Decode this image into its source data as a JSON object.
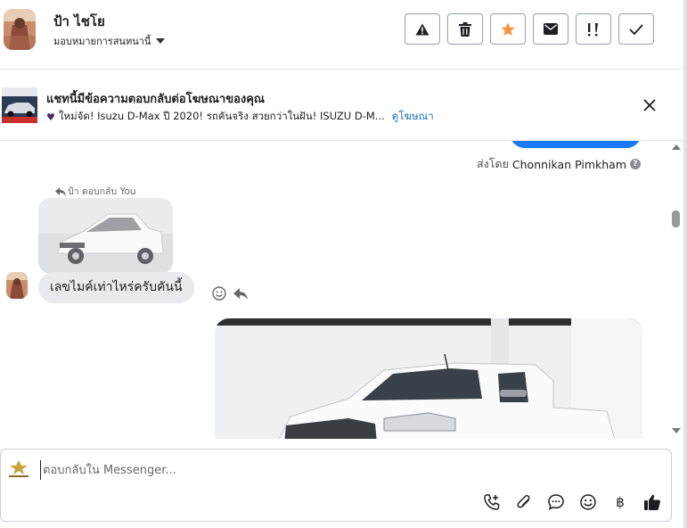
{
  "header": {
    "contact_name": "ป้า ไชโย",
    "assign_label": "มอบหมายการสนทนานี้",
    "toolbar": [
      {
        "name": "report-button",
        "icon": "warning-icon"
      },
      {
        "name": "delete-button",
        "icon": "trash-icon"
      },
      {
        "name": "star-button",
        "icon": "star-icon"
      },
      {
        "name": "mark-unread-button",
        "icon": "envelope-icon"
      },
      {
        "name": "follow-up-button",
        "icon": "exclamation-icon"
      },
      {
        "name": "mark-done-button",
        "icon": "check-icon"
      }
    ],
    "star_color": "#f7923a"
  },
  "ad_banner": {
    "title": "แชทนี้มีข้อความตอบกลับต่อโฆษณาของคุณ",
    "ad_text": "ใหม่จัด! Isuzu D-Max ปี 2020! รถคันจริง สวยกว่าในฝัน! ISUZU D-M...",
    "link_label": "ดูโฆษณา"
  },
  "chat": {
    "sent_by_prefix": "ส่งโดย",
    "sent_by_name": "Chonnikan Pimkham",
    "help_glyph": "?",
    "reply_info": "ป้า ตอบกลับ You",
    "incoming_message": "เลขไมค์เท่าไหร่ครับคันนี้",
    "accent_color": "#1a7af8"
  },
  "composer": {
    "placeholder": "ตอบกลับใน Messenger...",
    "baht_symbol": "฿",
    "tools": [
      "phone-add-icon",
      "paperclip-icon",
      "chat-bubble-icon",
      "emoji-icon",
      "baht-icon",
      "thumbs-up-icon"
    ]
  }
}
